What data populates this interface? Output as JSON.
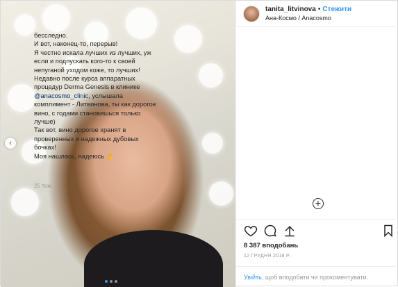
{
  "post": {
    "username": "tanita_litvinova",
    "separator": "•",
    "follow_label": "Стежити",
    "location": "Ана-Космо / Anacosmo",
    "caption": {
      "line1": "бесследно.",
      "line2": "И вот, наконец-то, перерыв!",
      "line3": "Я честно искала лучших из лучших, уж если и подпускать кого-то к своей непуганой уходом коже, то лучших!",
      "line4_prefix": "Недавно после курса аппаратных процедур Derma Genesis в клинике ",
      "mention": "@anacosmo_clinic",
      "line4_suffix": ", услышала комплимент - Литвинова, ты как дорогое вино, с годами становишься только лучше)",
      "line5": "Так вот, вино дорогое хранят в проверенных и надежных дубовых бочках!",
      "line6": "Моя нашлась, надеюсь 👌"
    },
    "time_ago": "25 тиж.",
    "likes": "8 387 вподобань",
    "date": "12 ГРУДНЯ 2018 Р.",
    "comment_login": "Увійть",
    "comment_rest": ", щоб вподобати чи прокоментувати.",
    "carousel": {
      "total": 3,
      "active_index": 0
    }
  },
  "icons": {
    "slide_prev": "chevron-left-icon",
    "load_more": "plus-circle-icon",
    "like": "heart-icon",
    "comment": "comment-icon",
    "share": "share-icon",
    "save": "bookmark-icon"
  },
  "colors": {
    "link": "#3897f0",
    "mention": "#003569",
    "muted": "#999999",
    "text": "#262626"
  }
}
